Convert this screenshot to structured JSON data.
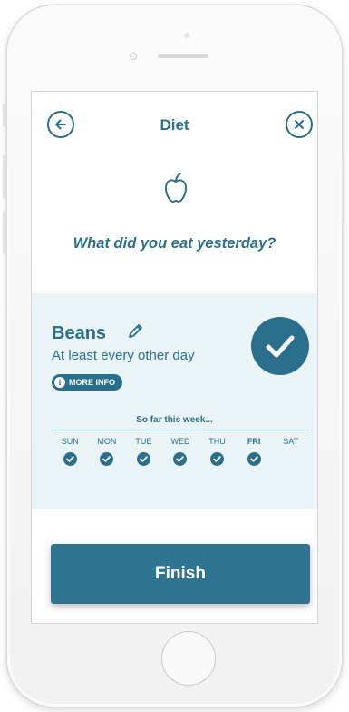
{
  "colors": {
    "primary": "#2a6f8c",
    "card_bg": "#eaf3f6",
    "button_bg": "#2f7490"
  },
  "header": {
    "title": "Diet",
    "back_icon": "arrow-left-icon",
    "close_icon": "close-icon"
  },
  "question": "What did you eat yesterday?",
  "item": {
    "name": "Beans",
    "frequency": "At least every other day",
    "more_info_label": "MORE INFO",
    "completed": true
  },
  "week": {
    "label": "So far this week...",
    "days": [
      {
        "label": "SUN",
        "checked": true
      },
      {
        "label": "MON",
        "checked": true
      },
      {
        "label": "TUE",
        "checked": true
      },
      {
        "label": "WED",
        "checked": true
      },
      {
        "label": "THU",
        "checked": true
      },
      {
        "label": "FRI",
        "checked": true,
        "current": true
      },
      {
        "label": "SAT",
        "checked": false
      }
    ]
  },
  "finish_label": "Finish"
}
